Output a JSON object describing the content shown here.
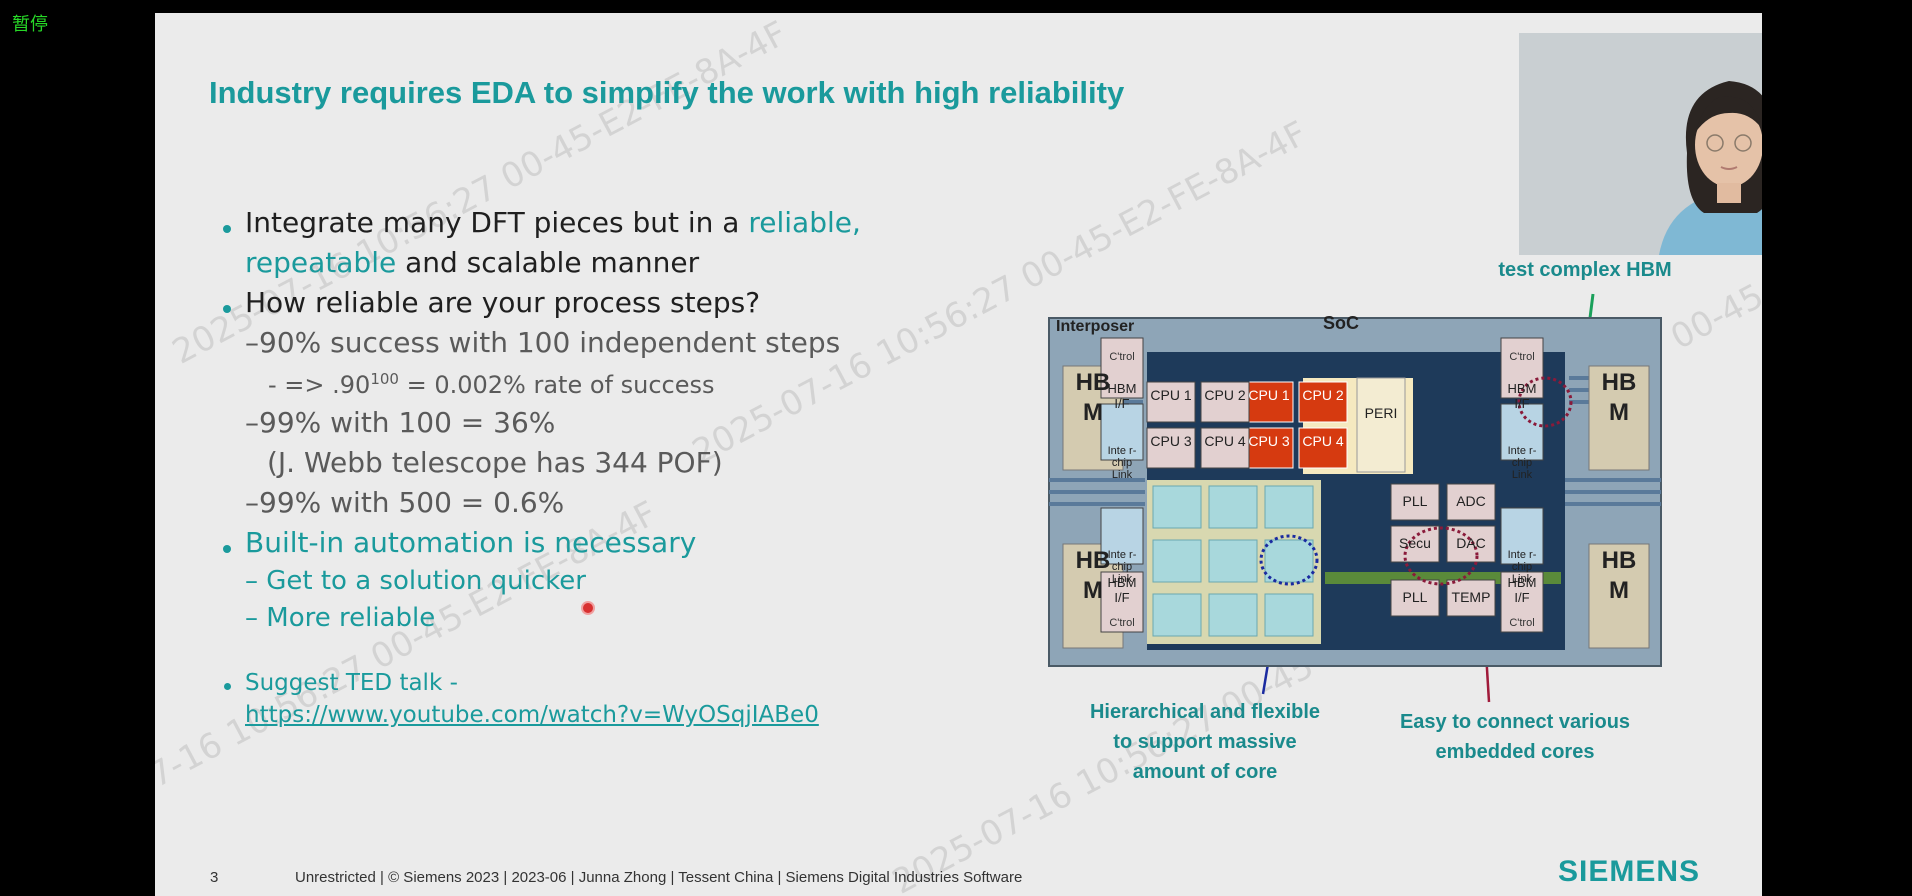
{
  "player": {
    "pause_label": "暂停"
  },
  "slide": {
    "title": "Industry requires EDA to simplify the work with high reliability",
    "bullets": {
      "b1_text": "Integrate many DFT pieces but in a ",
      "b1_hl": "reliable,",
      "b1_line2_hl": "repeatable",
      "b1_line2_text": " and scalable manner",
      "b2": "How reliable are your process steps?",
      "s1": "–90% success with 100 independent steps",
      "s1a_pre": "- => .90",
      "s1a_sup": "100",
      "s1a_post": " = 0.002% rate of success",
      "s2": "–99% with 100 = 36%",
      "s2b": "(J. Webb telescope has 344 POF)",
      "s3": "–99% with 500 = 0.6%",
      "b3": "Built-in automation is necessary",
      "s4": "– Get to a solution quicker",
      "s5": "– More reliable",
      "ted_label": "Suggest TED talk -",
      "ted_link": "https://www.youtube.com/watch?v=WyOSqjIABe0"
    },
    "diagram": {
      "interposer": "Interposer",
      "soc": "SoC",
      "hbm": "HB M",
      "hbm_if": "HBM I/F",
      "ctrl": "C'trol",
      "interchip": "Inte r- chip Link",
      "cpu_labels": [
        "CPU 1",
        "CPU 2",
        "CPU 3",
        "CPU 4"
      ],
      "peri": "PERI",
      "pll": "PLL",
      "adc": "ADC",
      "secu": "Secu",
      "dac": "DAC",
      "temp": "TEMP"
    },
    "callouts": {
      "top": "test complex HBM",
      "left": "Hierarchical and flexible to support massive amount of core",
      "right": "Easy to connect various embedded cores"
    },
    "footer": {
      "page": "3",
      "text": "Unrestricted | © Siemens 2023 | 2023-06 | Junna Zhong | Tessent China | Siemens Digital Industries Software",
      "brand": "SIEMENS"
    },
    "watermark": "2025-07-16 10:56:27 00-45-E2-FE-8A-4F"
  }
}
